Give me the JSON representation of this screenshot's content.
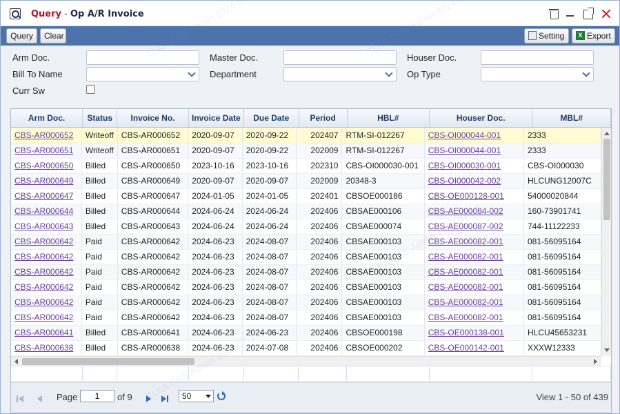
{
  "window": {
    "title_query": "Query",
    "title_sep": " - ",
    "title_main": "Op A/R Invoice"
  },
  "toolbar": {
    "query_label": "Query",
    "clear_label": "Clear",
    "setting_label": "Setting",
    "export_label": "Export"
  },
  "form": {
    "arm_doc_label": "Arm Doc.",
    "master_doc_label": "Master Doc.",
    "houser_doc_label": "Houser Doc.",
    "bill_to_name_label": "Bill To Name",
    "department_label": "Department",
    "op_type_label": "Op Type",
    "curr_sw_label": "Curr Sw",
    "arm_doc_value": "",
    "master_doc_value": "",
    "houser_doc_value": "",
    "bill_to_name_value": "",
    "department_value": "",
    "op_type_value": ""
  },
  "grid": {
    "columns": [
      "Arm Doc.",
      "Status",
      "Invoice No.",
      "Invoice Date",
      "Due Date",
      "Period",
      "HBL#",
      "Houser Doc.",
      "MBL#"
    ],
    "rows": [
      [
        "CBS-AR000652",
        "Writeoff",
        "CBS-AR000652",
        "2020-09-07",
        "2020-09-22",
        "202407",
        "RTM-SI-012267",
        "CBS-OI000044-001",
        "2333"
      ],
      [
        "CBS-AR000651",
        "Writeoff",
        "CBS-AR000651",
        "2020-09-07",
        "2020-09-22",
        "202009",
        "RTM-SI-012267",
        "CBS-OI000044-001",
        "2333"
      ],
      [
        "CBS-AR000650",
        "Billed",
        "CBS-AR000650",
        "2023-10-16",
        "2023-10-16",
        "202310",
        "CBS-OI000030-001",
        "CBS-OI000030-001",
        "CBS-OI000030"
      ],
      [
        "CBS-AR000649",
        "Billed",
        "CBS-AR000649",
        "2020-09-07",
        "2020-09-07",
        "202009",
        "20348-3",
        "CBS-OI000042-002",
        "HLCUNG12007C"
      ],
      [
        "CBS-AR000647",
        "Billed",
        "CBS-AR000647",
        "2024-01-05",
        "2024-01-05",
        "202401",
        "CBSOE000186",
        "CBS-OE000128-001",
        "54000020844"
      ],
      [
        "CBS-AR000644",
        "Billed",
        "CBS-AR000644",
        "2024-06-24",
        "2024-06-24",
        "202406",
        "CBSAE000106",
        "CBS-AE000084-002",
        "160-73901741"
      ],
      [
        "CBS-AR000643",
        "Billed",
        "CBS-AR000643",
        "2024-06-24",
        "2024-06-24",
        "202406",
        "CBSAE000074",
        "CBS-AE000087-002",
        "744-11122233"
      ],
      [
        "CBS-AR000642",
        "Paid",
        "CBS-AR000642",
        "2024-06-23",
        "2024-08-07",
        "202406",
        "CBSAE000103",
        "CBS-AE000082-001",
        "081-56095164"
      ],
      [
        "CBS-AR000642",
        "Paid",
        "CBS-AR000642",
        "2024-06-23",
        "2024-08-07",
        "202406",
        "CBSAE000103",
        "CBS-AE000082-001",
        "081-56095164"
      ],
      [
        "CBS-AR000642",
        "Paid",
        "CBS-AR000642",
        "2024-06-23",
        "2024-08-07",
        "202406",
        "CBSAE000103",
        "CBS-AE000082-001",
        "081-56095164"
      ],
      [
        "CBS-AR000642",
        "Paid",
        "CBS-AR000642",
        "2024-06-23",
        "2024-08-07",
        "202406",
        "CBSAE000103",
        "CBS-AE000082-001",
        "081-56095164"
      ],
      [
        "CBS-AR000642",
        "Paid",
        "CBS-AR000642",
        "2024-06-23",
        "2024-08-07",
        "202406",
        "CBSAE000103",
        "CBS-AE000082-001",
        "081-56095164"
      ],
      [
        "CBS-AR000642",
        "Paid",
        "CBS-AR000642",
        "2024-06-23",
        "2024-08-07",
        "202406",
        "CBSAE000103",
        "CBS-AE000082-001",
        "081-56095164"
      ],
      [
        "CBS-AR000641",
        "Billed",
        "CBS-AR000641",
        "2024-06-23",
        "2024-06-23",
        "202406",
        "CBSOE000198",
        "CBS-OE000138-001",
        "HLCU45653231"
      ],
      [
        "CBS-AR000638",
        "Billed",
        "CBS-AR000638",
        "2024-06-23",
        "2024-07-08",
        "202406",
        "CBSOE000202",
        "CBS-OE000142-001",
        "XXXW12333"
      ]
    ]
  },
  "pager": {
    "page_label": "Page",
    "page_value": "1",
    "of_label": "of 9",
    "page_size": "50",
    "view_text": "View 1 - 50 of 439"
  },
  "watermark": "TLKA.CBS.Admin 2024-07-17",
  "colors": {
    "toolbar_bg": "#4c73ab",
    "selected_row": "#fffcd4",
    "link": "#6a3f9a",
    "title_accent": "#b3142a"
  }
}
